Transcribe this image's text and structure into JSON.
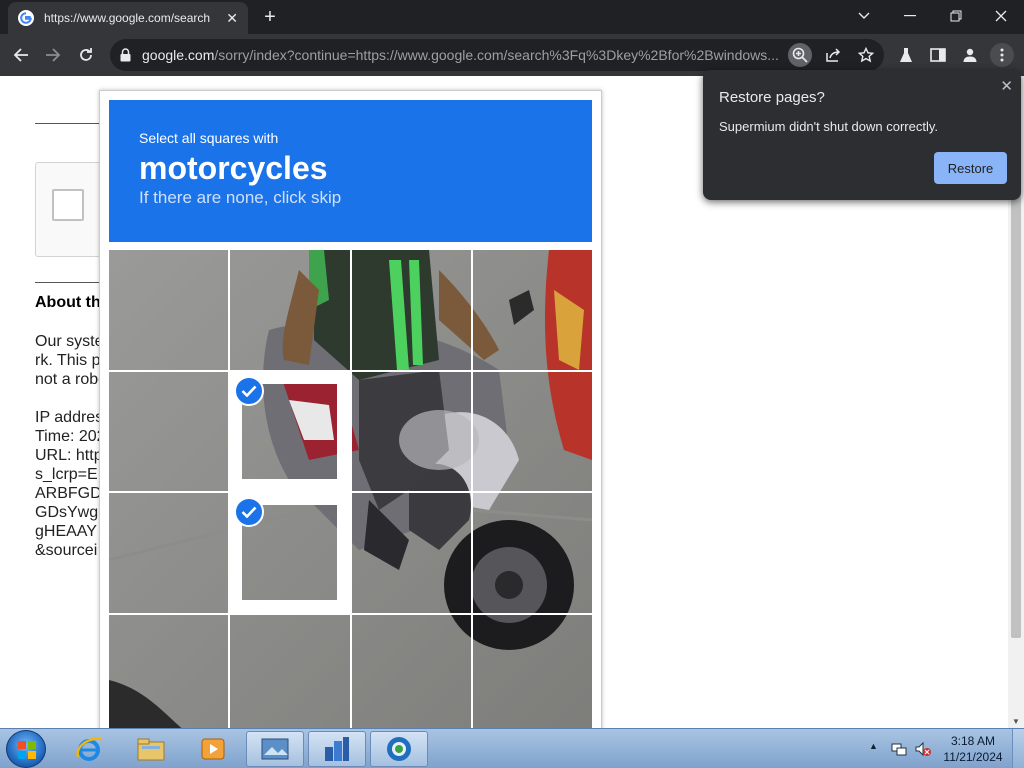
{
  "browser": {
    "tab_title": "https://www.google.com/search",
    "url_host": "google.com",
    "url_rest": "/sorry/index?continue=https://www.google.com/search%3Fq%3Dkey%2Bfor%2Bwindows..."
  },
  "page": {
    "about_heading": "About th",
    "para1": [
      "Our syste",
      "rk. This p",
      "not a robo"
    ],
    "para2": [
      "IP addres",
      "Time: 202",
      "URL: http",
      "s_lcrp=E",
      "ARBFGD",
      "GDsYwg",
      "gHEAAY",
      "&sourcei"
    ]
  },
  "captcha": {
    "lead": "Select all squares with",
    "target": "motorcycles",
    "hint": "If there are none, click skip",
    "grid_size": 4,
    "selected_tiles": [
      5,
      9
    ]
  },
  "popup": {
    "title": "Restore pages?",
    "message": "Supermium didn't shut down correctly.",
    "restore_label": "Restore"
  },
  "taskbar": {
    "time": "3:18 AM",
    "date": "11/21/2024"
  },
  "colors": {
    "captcha_blue": "#1a73e8",
    "restore_button": "#8ab4f8",
    "chrome_dark": "#202124"
  }
}
